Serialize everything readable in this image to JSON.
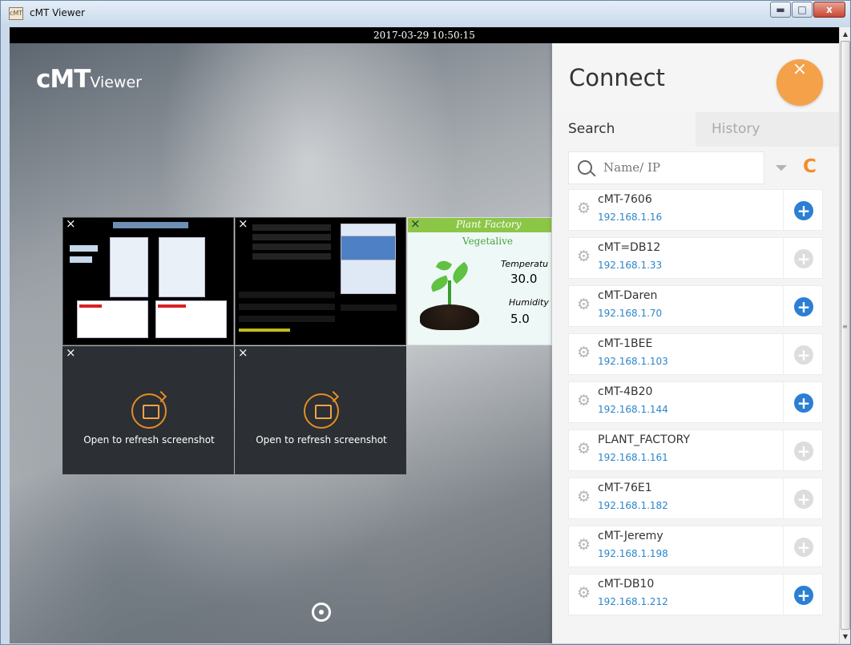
{
  "window": {
    "title": "cMT Viewer",
    "icon_text": "cMT",
    "minimize": "▬",
    "maximize": "□",
    "close": "x"
  },
  "timestamp": "2017-03-29 10:50:15",
  "logo": {
    "main": "cMT",
    "sub": "Viewer"
  },
  "thumbnails": {
    "close_glyph": "×",
    "refresh_text": "Open to refresh screenshot",
    "plant": {
      "title": "Plant Factory",
      "stage": "Vegetalive",
      "temperature_label": "Temperatu",
      "temperature_value": "30.0",
      "humidity_label": "Humidity",
      "humidity_value": "5.0"
    }
  },
  "connect": {
    "title": "Connect",
    "close_glyph": "×",
    "tabs": {
      "search": "Search",
      "history": "History"
    },
    "search_placeholder": "Name/ IP",
    "filter_glyph": "⏷",
    "refresh_glyph": "C",
    "devices": [
      {
        "name": "cMT-7606",
        "ip": "192.168.1.16",
        "add_active": true
      },
      {
        "name": "cMT=DB12",
        "ip": "192.168.1.33",
        "add_active": false
      },
      {
        "name": "cMT-Daren",
        "ip": "192.168.1.70",
        "add_active": true
      },
      {
        "name": "cMT-1BEE",
        "ip": "192.168.1.103",
        "add_active": false
      },
      {
        "name": "cMT-4B20",
        "ip": "192.168.1.144",
        "add_active": true
      },
      {
        "name": "PLANT_FACTORY",
        "ip": "192.168.1.161",
        "add_active": false
      },
      {
        "name": "cMT-76E1",
        "ip": "192.168.1.182",
        "add_active": false
      },
      {
        "name": "cMT-Jeremy",
        "ip": "192.168.1.198",
        "add_active": false
      },
      {
        "name": "cMT-DB10",
        "ip": "192.168.1.212",
        "add_active": true
      }
    ],
    "add_glyph": "+",
    "gear_glyph": "⚙"
  },
  "scrollbar": {
    "up": "▲",
    "down": "▼",
    "grip": "≡"
  }
}
